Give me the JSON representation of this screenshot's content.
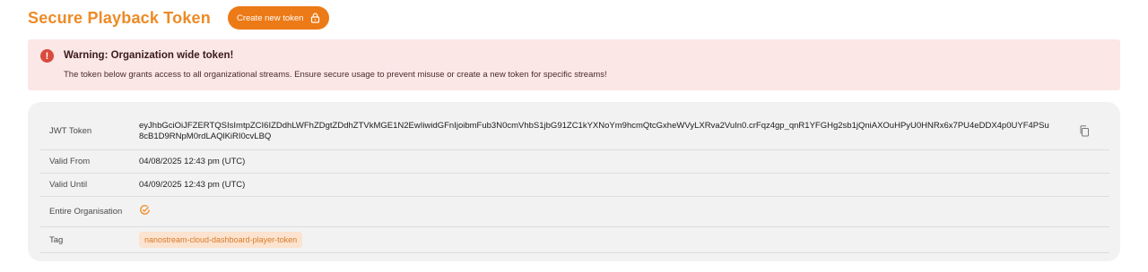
{
  "header": {
    "title": "Secure Playback Token",
    "create_button_label": "Create new token"
  },
  "warning": {
    "title": "Warning: Organization wide token!",
    "message": "The token below grants access to all organizational streams. Ensure secure usage to prevent misuse or create a new token for specific streams!",
    "icon": "exclamation-icon",
    "color": "#d94b3d"
  },
  "token": {
    "rows": [
      {
        "label": "JWT Token",
        "value": "eyJhbGciOiJFZERTQSIsImtpZCI6IZDdhLWFhZDgtZDdhZTVkMGE1N2EwIiwidGFnIjoibmFub3N0cmVhbS1jbG91ZC1kYXNoYm9hcmQtcGxheWVyLXRva2VuIn0.crFqz4gp_qnR1YFGHg2sb1jQniAXOuHPyU0HNRx6x7PU4eDDX4p0UYF4PSu8cB1D9RNpM0rdLAQlKiRI0cvLBQ"
      },
      {
        "label": "Valid From",
        "value": "04/08/2025 12:43 pm (UTC)"
      },
      {
        "label": "Valid Until",
        "value": "04/09/2025 12:43 pm (UTC)"
      },
      {
        "label": "Entire Organisation",
        "value_icon": "check-circle-icon"
      },
      {
        "label": "Tag",
        "value": "nanostream-cloud-dashboard-player-token"
      }
    ]
  },
  "colors": {
    "accent": "#ec7a16",
    "warning_bg": "#fbe7e6",
    "card_bg": "#f2f2f2"
  }
}
